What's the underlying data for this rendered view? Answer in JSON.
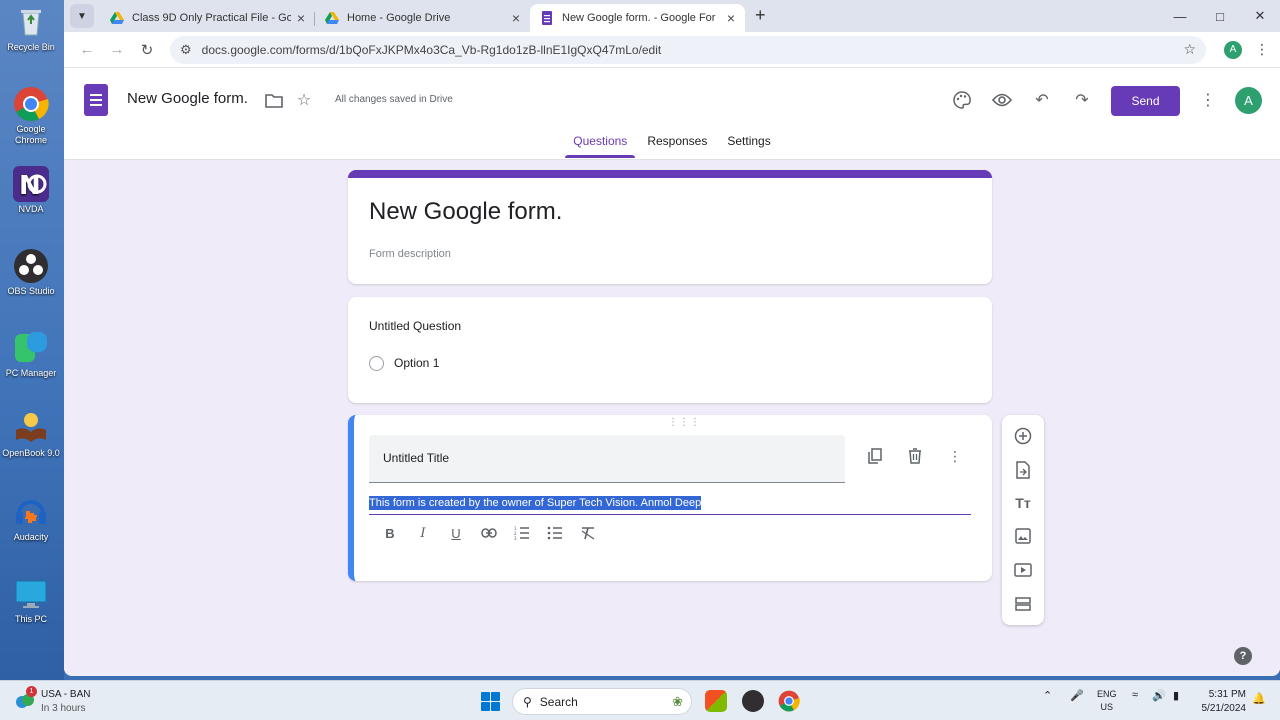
{
  "desktop": {
    "icons": [
      {
        "label": "Recycle Bin"
      },
      {
        "label": "Google Chrome"
      },
      {
        "label": "NVDA"
      },
      {
        "label": "OBS Studio"
      },
      {
        "label": "PC Manager"
      },
      {
        "label": "OpenBook 9.0"
      },
      {
        "label": "Audacity"
      },
      {
        "label": "This PC"
      }
    ]
  },
  "browser": {
    "tabs": [
      {
        "title": "Class 9D Only Practical File - Go",
        "icon": "google-drive-icon",
        "active": false
      },
      {
        "title": "Home - Google Drive",
        "icon": "google-drive-icon",
        "active": false
      },
      {
        "title": "New Google form. - Google For",
        "icon": "google-forms-icon",
        "active": true
      }
    ],
    "url": "docs.google.com/forms/d/1bQoFxJKPMx4o3Ca_Vb-Rg1do1zB-llnE1IgQxQ47mLo/edit",
    "profile_initial": "A"
  },
  "forms_header": {
    "doc_title": "New Google form.",
    "saved_status": "All changes saved in Drive",
    "send_label": "Send",
    "avatar_initial": "A",
    "tabs": [
      {
        "label": "Questions",
        "active": true
      },
      {
        "label": "Responses",
        "active": false
      },
      {
        "label": "Settings",
        "active": false
      }
    ]
  },
  "form": {
    "title": "New Google form.",
    "description_placeholder": "Form description",
    "question": {
      "title": "Untitled Question",
      "option": "Option 1"
    },
    "section": {
      "title": "Untitled Title",
      "description": "This form is created by the owner of Super Tech Vision. Anmol Deep"
    }
  },
  "taskbar": {
    "weather": {
      "badge": "1",
      "line1": "USA - BAN",
      "line2": "In 3 hours"
    },
    "search_label": "Search",
    "lang_line1": "ENG",
    "lang_line2": "US",
    "time": "5:31 PM",
    "date": "5/21/2024"
  },
  "colors": {
    "forms_purple": "#673ab7",
    "canvas_bg": "#f0ebf8",
    "active_card_border": "#4285f4",
    "selection": "#3367d6"
  }
}
